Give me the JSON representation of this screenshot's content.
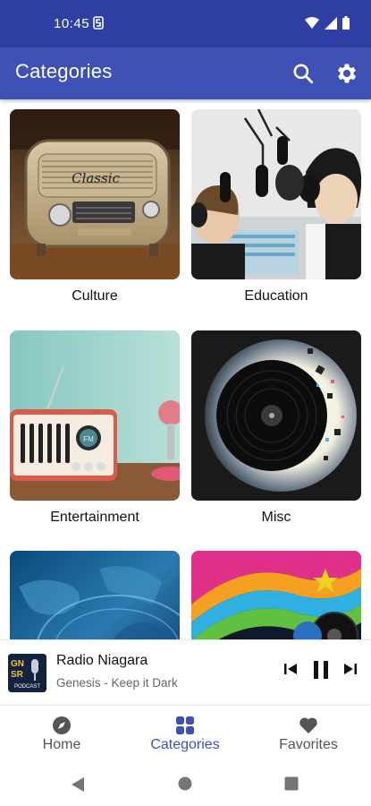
{
  "status_bar": {
    "time": "10:45"
  },
  "app_bar": {
    "title": "Categories",
    "search_icon": "search-icon",
    "settings_icon": "gear-icon"
  },
  "categories": [
    {
      "label": "Culture"
    },
    {
      "label": "Education"
    },
    {
      "label": "Entertainment"
    },
    {
      "label": "Misc"
    },
    {
      "label": ""
    },
    {
      "label": ""
    }
  ],
  "player": {
    "title": "Radio Niagara",
    "subtitle": "Genesis - Keep it Dark",
    "artwork_text": "GN SR PODCAST"
  },
  "bottom_nav": {
    "items": [
      {
        "label": "Home",
        "icon": "compass-icon",
        "active": false
      },
      {
        "label": "Categories",
        "icon": "grid-icon",
        "active": true
      },
      {
        "label": "Favorites",
        "icon": "heart-icon",
        "active": false
      }
    ]
  },
  "colors": {
    "primary": "#3f51b5",
    "status_bar": "#2f3fa3",
    "active": "#3f51b5",
    "inactive": "#555555"
  }
}
